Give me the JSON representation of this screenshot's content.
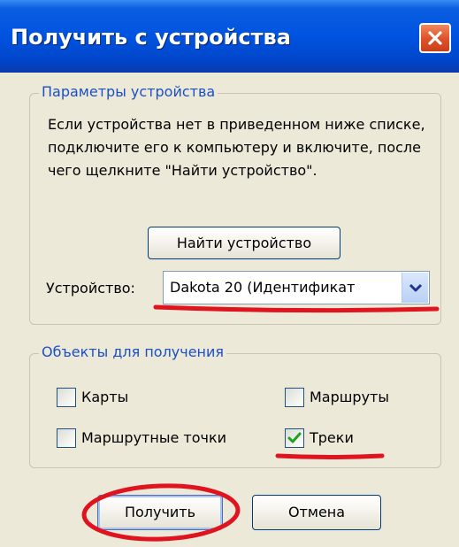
{
  "window": {
    "title": "Получить с устройства",
    "close_icon": "close-icon"
  },
  "device_params": {
    "group_title": "Параметры устройства",
    "description": "Если устройства нет в приведенном ниже списке, подключите его к компьютеру и включите, после чего щелкните \"Найти устройство\".",
    "find_button_label": "Найти устройство",
    "device_label": "Устройство:",
    "device_value": "Dakota 20 (Идентификат",
    "dropdown_icon": "chevron-down-icon"
  },
  "objects": {
    "group_title": "Объекты для получения",
    "items": [
      {
        "label": "Карты",
        "checked": false
      },
      {
        "label": "Маршруты",
        "checked": false
      },
      {
        "label": "Маршрутные точки",
        "checked": false
      },
      {
        "label": "Треки",
        "checked": true
      }
    ]
  },
  "buttons": {
    "get_label": "Получить",
    "cancel_label": "Отмена"
  },
  "colors": {
    "titlebar": "#0053e0",
    "close_button": "#e0542a",
    "group_title": "#1c4fc4",
    "annotation_marker": "#e0141e"
  }
}
